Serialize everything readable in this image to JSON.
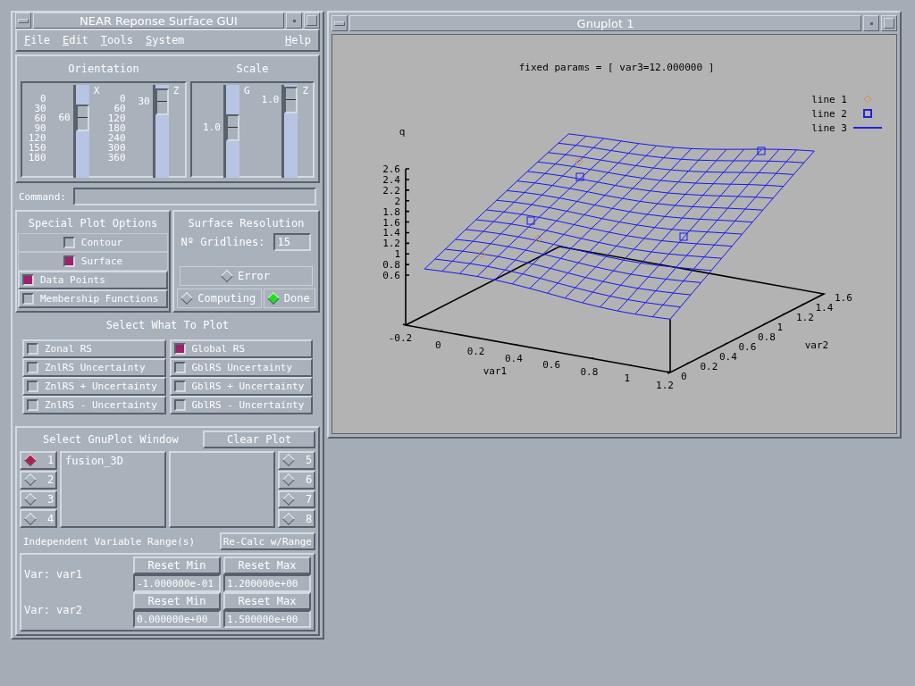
{
  "control_window": {
    "title": "NEAR Reponse Surface GUI",
    "menu": [
      {
        "label": "File"
      },
      {
        "label": "Edit"
      },
      {
        "label": "Tools"
      },
      {
        "label": "System"
      },
      {
        "label": "Help"
      }
    ],
    "orientation": {
      "title": "Orientation",
      "sliders": [
        {
          "axis": "X",
          "value": "60",
          "ticks": [
            "0",
            "30",
            "60",
            "90",
            "120",
            "150",
            "180"
          ],
          "level": 0.3
        },
        {
          "axis": "Z",
          "value": "30",
          "ticks": [
            "0",
            "60",
            "120",
            "180",
            "240",
            "300",
            "360"
          ],
          "level": 0.06
        }
      ]
    },
    "scale": {
      "title": "Scale",
      "sliders": [
        {
          "axis": "G",
          "value": "1.0",
          "level": 0.45
        },
        {
          "axis": "Z",
          "value": "1.0",
          "level": 0.03
        }
      ]
    },
    "command": {
      "label": "Command:"
    },
    "special_plot_options": {
      "title": "Special Plot Options",
      "options": [
        {
          "label": "Contour",
          "checked": false
        },
        {
          "label": "Surface",
          "checked": true
        },
        {
          "label": "Data Points",
          "checked": true
        },
        {
          "label": "Membership Functions",
          "checked": false
        }
      ]
    },
    "surface_resolution": {
      "title": "Surface Resolution",
      "gridlines_label": "Nº Gridlines:",
      "gridlines_value": "15",
      "status_lights": [
        {
          "label": "Error",
          "on": false
        },
        {
          "label": "Computing",
          "on": false
        },
        {
          "label": "Done",
          "on": true
        }
      ]
    },
    "select_what_to_plot": {
      "title": "Select What To Plot",
      "items": [
        {
          "label": "Zonal RS",
          "checked": false
        },
        {
          "label": "ZnlRS Uncertainty",
          "checked": false
        },
        {
          "label": "ZnlRS + Uncertainty",
          "checked": false
        },
        {
          "label": "ZnlRS - Uncertainty",
          "checked": false
        },
        {
          "label": "Global RS",
          "checked": true
        },
        {
          "label": "GblRS Uncertainty",
          "checked": false
        },
        {
          "label": "GblRS + Uncertainty",
          "checked": false
        },
        {
          "label": "GblRS - Uncertainty",
          "checked": false
        }
      ]
    },
    "gnuplot_window": {
      "title": "Select GnuPlot Window",
      "clear_button": "Clear Plot",
      "windows": [
        {
          "label": "1",
          "selected": true
        },
        {
          "label": "2",
          "selected": false
        },
        {
          "label": "3",
          "selected": false
        },
        {
          "label": "4",
          "selected": false
        },
        {
          "label": "5",
          "selected": false
        },
        {
          "label": "6",
          "selected": false
        },
        {
          "label": "7",
          "selected": false
        },
        {
          "label": "8",
          "selected": false
        }
      ],
      "plot_list": [
        "fusion_3D"
      ]
    },
    "variable_range": {
      "title": "Independent Variable Range(s)",
      "recalc_button": "Re-Calc w/Range",
      "variables": [
        {
          "label": "Var: var1",
          "reset_min": "Reset Min",
          "min": "-1.000000e-01",
          "reset_max": "Reset Max",
          "max": "1.200000e+00"
        },
        {
          "label": "Var: var2",
          "reset_min": "Reset Min",
          "min": "0.000000e+00",
          "reset_max": "Reset Max",
          "max": "1.500000e+00"
        }
      ]
    }
  },
  "plot_window": {
    "title": "Gnuplot 1",
    "plot": {
      "title": "fixed params = [ var3=12.000000 ]",
      "legend": [
        {
          "label": "line 1",
          "kind": "diamond",
          "color": "#d09040"
        },
        {
          "label": "line 2",
          "kind": "square",
          "color": "#2020e0"
        },
        {
          "label": "line 3",
          "kind": "line",
          "color": "#2020e0"
        }
      ],
      "zlabel": "q",
      "zticks": [
        "2.6",
        "2.4",
        "2.2",
        "2",
        "1.8",
        "1.6",
        "1.4",
        "1.2",
        "1",
        "0.8",
        "0.6"
      ],
      "xlabel": "var1",
      "xticks": [
        "-0.2",
        "0",
        "0.2",
        "0.4",
        "0.6",
        "0.8",
        "1",
        "1.2"
      ],
      "ylabel": "var2",
      "yticks": [
        "0",
        "0.2",
        "0.4",
        "0.6",
        "0.8",
        "1",
        "1.2",
        "1.4",
        "1.6"
      ]
    }
  }
}
